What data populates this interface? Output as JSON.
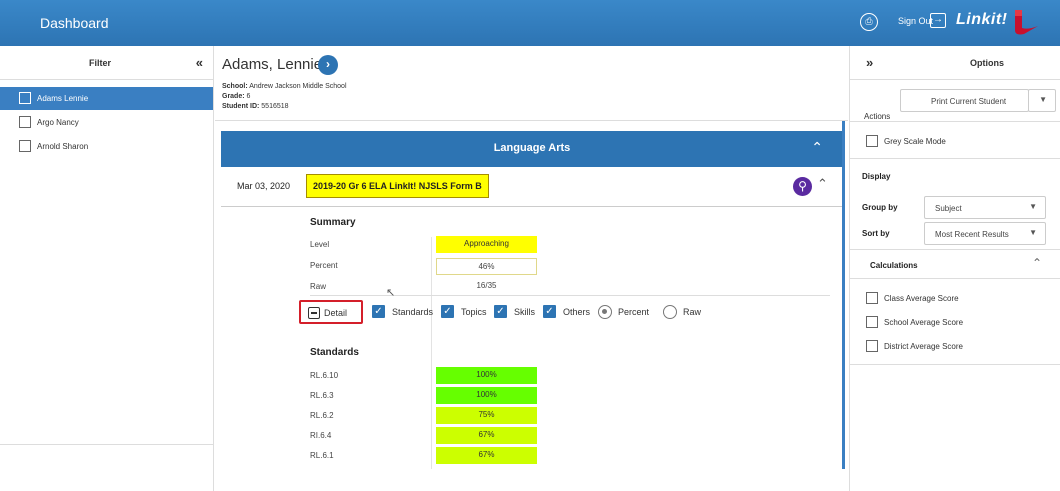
{
  "header": {
    "title": "Dashboard",
    "pdf_icon": "pdf-icon",
    "sign_out_label": "Sign Out",
    "sign_out_icon": "sign-out-icon",
    "logo_text": "Linkit!"
  },
  "filter": {
    "title": "Filter",
    "collapse_glyph": "«",
    "students": [
      {
        "name": "Adams Lennie",
        "selected": true
      },
      {
        "name": "Argo Nancy",
        "selected": false
      },
      {
        "name": "Arnold Sharon",
        "selected": false
      }
    ]
  },
  "student": {
    "name": "Adams, Lennie",
    "school_label": "School:",
    "school": "Andrew Jackson Middle School",
    "grade_label": "Grade:",
    "grade": "6",
    "id_label": "Student ID:",
    "id": "5516518"
  },
  "subject": {
    "title": "Language Arts"
  },
  "test": {
    "date": "Mar 03, 2020",
    "name": "2019-20 Gr 6 ELA LinkIt! NJSLS Form B"
  },
  "summary": {
    "title": "Summary",
    "rows": [
      {
        "label": "Level",
        "value": "Approaching"
      },
      {
        "label": "Percent",
        "value": "46%"
      },
      {
        "label": "Raw",
        "value": "16/35"
      }
    ]
  },
  "options_row": {
    "detail_label": "Detail",
    "standards_label": "Standards",
    "topics_label": "Topics",
    "skills_label": "Skills",
    "others_label": "Others",
    "percent_label": "Percent",
    "raw_label": "Raw",
    "selected_mode": "Percent"
  },
  "standards": {
    "title": "Standards",
    "rows": [
      {
        "label": "RL.6.10",
        "value": "100%",
        "percent": 100,
        "color": "#66ff00"
      },
      {
        "label": "RL.6.3",
        "value": "100%",
        "percent": 100,
        "color": "#66ff00"
      },
      {
        "label": "RL.6.2",
        "value": "75%",
        "percent": 75,
        "color": "#ccff00"
      },
      {
        "label": "RI.6.4",
        "value": "67%",
        "percent": 67,
        "color": "#ccff00"
      },
      {
        "label": "RL.6.1",
        "value": "67%",
        "percent": 67,
        "color": "#ccff00"
      }
    ]
  },
  "options_panel": {
    "title": "Options",
    "expand_glyph": "»",
    "actions_label": "Actions",
    "actions_value": "Print Current Student",
    "grey_scale_label": "Grey Scale Mode",
    "display_label": "Display",
    "group_by_label": "Group by",
    "group_by_value": "Subject",
    "sort_by_label": "Sort by",
    "sort_by_value": "Most Recent Results",
    "calculations_label": "Calculations",
    "calculations": [
      "Class Average Score",
      "School Average Score",
      "District Average Score"
    ]
  },
  "colors": {
    "header_blue": "#2d74b3",
    "selected_row": "#3a7fc2",
    "test_highlight": "#ffff00",
    "level_approaching": "#ffff00",
    "magnify_purple": "#5a2aa0",
    "detail_outline": "#d41f2a"
  }
}
